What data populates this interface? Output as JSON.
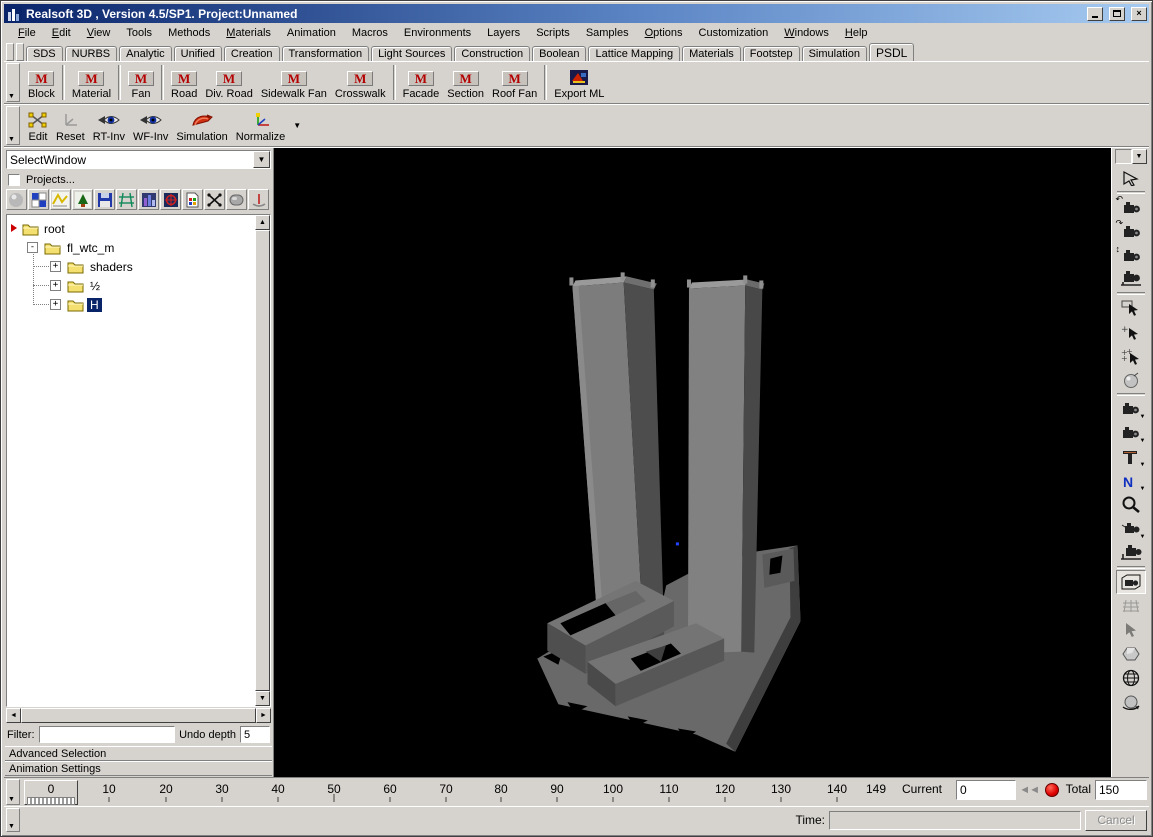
{
  "window": {
    "title": "Realsoft 3D , Version 4.5/SP1. Project:Unnamed",
    "controls": {
      "minimize": "minimize",
      "maximize": "maximize",
      "close": "X"
    }
  },
  "menu": {
    "items": [
      {
        "label": "File",
        "u": 0
      },
      {
        "label": "Edit",
        "u": 0
      },
      {
        "label": "View",
        "u": 0
      },
      {
        "label": "Tools",
        "u": -1
      },
      {
        "label": "Methods",
        "u": -1
      },
      {
        "label": "Materials",
        "u": 0
      },
      {
        "label": "Animation",
        "u": -1
      },
      {
        "label": "Macros",
        "u": -1
      },
      {
        "label": "Environments",
        "u": -1
      },
      {
        "label": "Layers",
        "u": -1
      },
      {
        "label": "Scripts",
        "u": -1
      },
      {
        "label": "Samples",
        "u": -1
      },
      {
        "label": "Options",
        "u": 0
      },
      {
        "label": "Customization",
        "u": -1
      },
      {
        "label": "Windows",
        "u": 0
      },
      {
        "label": "Help",
        "u": 0
      }
    ]
  },
  "tabs": {
    "items": [
      "SDS",
      "NURBS",
      "Analytic",
      "Unified",
      "Creation",
      "Transformation",
      "Light Sources",
      "Construction",
      "Boolean",
      "Lattice Mapping",
      "Materials",
      "Footstep",
      "Simulation",
      "PSDL"
    ],
    "active": "PSDL"
  },
  "toolbar_psdl": {
    "icon_letter": "M",
    "buttons": [
      {
        "label": "Block"
      },
      {
        "label": "Material"
      },
      {
        "label": "Fan"
      },
      {
        "label": "Road"
      },
      {
        "label": "Div. Road"
      },
      {
        "label": "Sidewalk Fan"
      },
      {
        "label": "Crosswalk"
      },
      {
        "label": "Facade"
      },
      {
        "label": "Section"
      },
      {
        "label": "Roof Fan"
      },
      {
        "label": "Export ML"
      }
    ]
  },
  "toolbar_edit": {
    "buttons": [
      {
        "label": "Edit",
        "icon": "edit-points-icon"
      },
      {
        "label": "Reset",
        "icon": "reset-axes-icon"
      },
      {
        "label": "RT-Inv",
        "icon": "eye-raytrace-icon"
      },
      {
        "label": "WF-Inv",
        "icon": "eye-wireframe-icon"
      },
      {
        "label": "Simulation",
        "icon": "simulation-swoosh-icon"
      },
      {
        "label": "Normalize",
        "icon": "normalize-axes-icon"
      }
    ]
  },
  "left_panel": {
    "selector_value": "SelectWindow",
    "projects_label": "Projects...",
    "projects_checked": false,
    "icon_names": [
      "sphere-icon",
      "checker-icon",
      "curve-icon",
      "tree-icon",
      "save-icon",
      "grid-icon",
      "levels-icon",
      "target-icon",
      "document-icon",
      "skeleton-icon",
      "blob-icon",
      "axis-icon"
    ],
    "tree": {
      "items": [
        {
          "label": "root",
          "level": 0
        },
        {
          "label": "fl_wtc_m",
          "level": 1,
          "expander": "-"
        },
        {
          "label": "shaders",
          "level": 2,
          "expander": "+"
        },
        {
          "label": "½",
          "level": 2,
          "expander": "+"
        },
        {
          "label": "H",
          "level": 2,
          "expander": "+",
          "selected": true
        }
      ]
    },
    "filter_label": "Filter:",
    "filter_value": "",
    "undo_label": "Undo depth",
    "undo_value": "5",
    "sections": [
      {
        "label": "Advanced Selection"
      },
      {
        "label": "Animation Settings"
      }
    ]
  },
  "right_toolbar": {
    "icon_names": [
      "dropdown-arrow",
      "raytrace-pointer-icon",
      "camera-rotate-icon",
      "camera-orbit-icon",
      "camera-vertical-icon",
      "camera-horizontal-icon",
      "select-object-icon",
      "select-add-icon",
      "select-multi-icon",
      "sphere-select-icon",
      "camera-view-icon",
      "camera-target-icon",
      "drafting-icon",
      "normals-icon",
      "zoom-icon",
      "camera-pan-icon",
      "camera-align-icon",
      "camera-frame-icon",
      "grid-snap-icon",
      "pointer-disabled-icon",
      "polygon-icon",
      "globe-icon",
      "orbit-ball-icon"
    ]
  },
  "timeline": {
    "slider_value": "0",
    "ticks": [
      "10",
      "20",
      "30",
      "40",
      "50",
      "60",
      "70",
      "80",
      "90",
      "100",
      "110",
      "120",
      "130",
      "140",
      "149"
    ],
    "current_label": "Current",
    "current_value": "0",
    "total_label": "Total",
    "total_value": "150"
  },
  "status_bar": {
    "time_label": "Time:",
    "time_value": "",
    "cancel_label": "Cancel"
  },
  "viewport": {
    "colors": {
      "bg": "#000000",
      "tower_front": "#7c7c7c",
      "tower_front2": "#818181",
      "tower_side": "#4d4d4d",
      "tower_top": "#9a9a9a",
      "plaza": "#696969",
      "plaza_dark": "#3e3e3e",
      "marker_blue": "#2244ff"
    }
  }
}
